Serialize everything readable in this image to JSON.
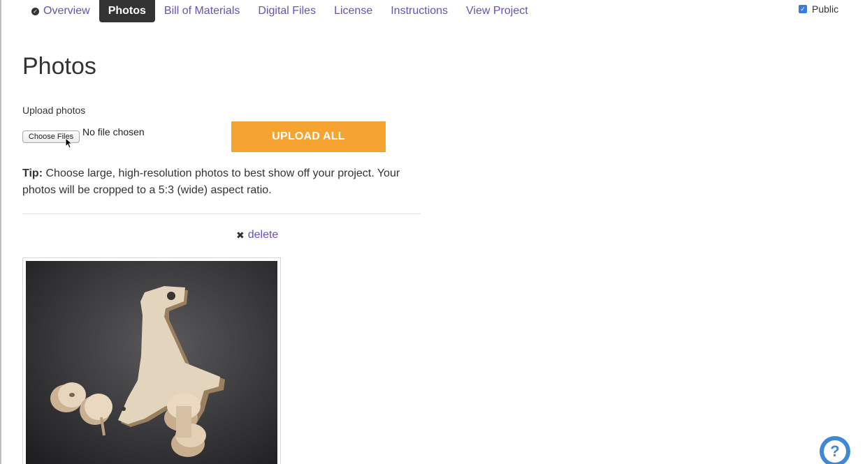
{
  "nav": {
    "items": [
      {
        "label": "Overview",
        "active": false,
        "completed": true
      },
      {
        "label": "Photos",
        "active": true
      },
      {
        "label": "Bill of Materials",
        "active": false
      },
      {
        "label": "Digital Files",
        "active": false
      },
      {
        "label": "License",
        "active": false
      },
      {
        "label": "Instructions",
        "active": false
      },
      {
        "label": "View Project",
        "active": false
      }
    ],
    "public_label": "Public",
    "public_checked": true
  },
  "page": {
    "title": "Photos"
  },
  "upload": {
    "label": "Upload photos",
    "choose_button": "Choose Files",
    "no_file_text": "No file chosen",
    "upload_all_button": "UPLOAD ALL"
  },
  "tip": {
    "prefix": "Tip:",
    "text": "Choose large, high-resolution photos to best show off your project. Your photos will be cropped to a 5:3 (wide) aspect ratio."
  },
  "photo_item": {
    "delete_label": "delete",
    "delete_icon": "close-icon",
    "image_description_icon": "wooden-giraffe-toy-photo"
  },
  "help": {
    "icon": "help-question-icon",
    "glyph": "?"
  },
  "colors": {
    "link": "#6b4fbb",
    "accent_button": "#f5a431",
    "active_tab": "#333333",
    "help_button": "#3f88d6",
    "checkbox": "#3b7ddd"
  }
}
